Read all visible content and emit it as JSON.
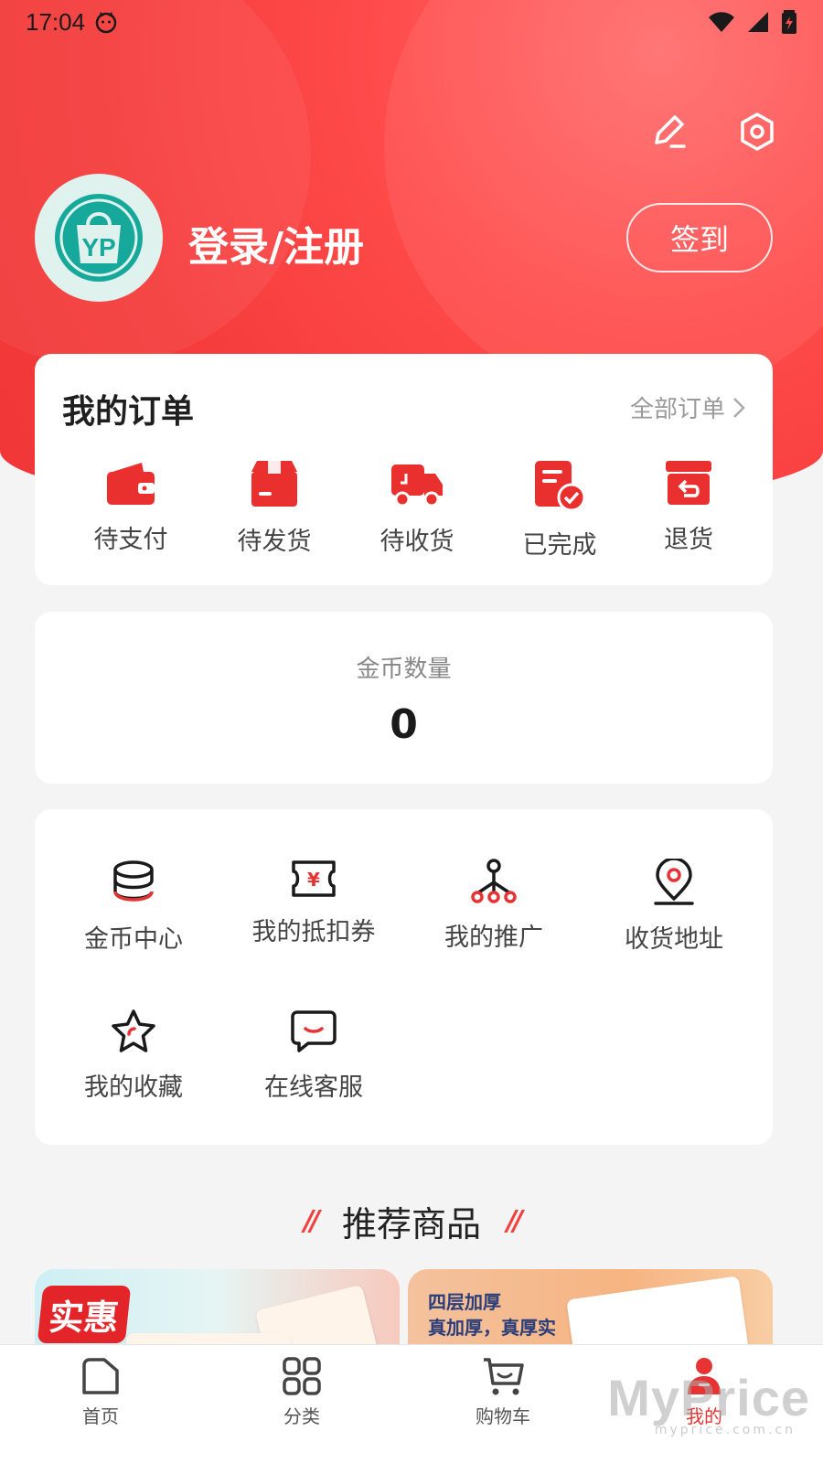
{
  "status": {
    "time": "17:04"
  },
  "profile": {
    "login_text": "登录/注册",
    "signin_label": "签到"
  },
  "orders": {
    "title": "我的订单",
    "all_label": "全部订单",
    "items": [
      {
        "label": "待支付",
        "icon": "wallet-icon"
      },
      {
        "label": "待发货",
        "icon": "package-icon"
      },
      {
        "label": "待收货",
        "icon": "truck-icon"
      },
      {
        "label": "已完成",
        "icon": "document-check-icon"
      },
      {
        "label": "退货",
        "icon": "return-box-icon"
      }
    ]
  },
  "coins": {
    "label": "金币数量",
    "value": "0"
  },
  "menu": {
    "items": [
      {
        "label": "金币中心",
        "icon": "coin-stack-icon"
      },
      {
        "label": "我的抵扣券",
        "icon": "coupon-icon"
      },
      {
        "label": "我的推广",
        "icon": "network-icon"
      },
      {
        "label": "收货地址",
        "icon": "location-pin-icon"
      },
      {
        "label": "我的收藏",
        "icon": "star-icon"
      },
      {
        "label": "在线客服",
        "icon": "chat-icon"
      }
    ]
  },
  "recommend": {
    "title": "推荐商品",
    "product1_tag": "实惠",
    "product2_line1": "四层加厚",
    "product2_line2": "真加厚，真厚实"
  },
  "nav": {
    "items": [
      {
        "label": "首页",
        "icon": "home-icon"
      },
      {
        "label": "分类",
        "icon": "grid-icon"
      },
      {
        "label": "购物车",
        "icon": "cart-icon"
      },
      {
        "label": "我的",
        "icon": "user-icon"
      }
    ],
    "active": "我的"
  },
  "watermark": {
    "text": "MyPrice",
    "sub": "myprice.com.cn"
  },
  "colors": {
    "brand_red": "#f03636",
    "icon_red": "#e73333",
    "avatar_teal": "#16a89a"
  }
}
